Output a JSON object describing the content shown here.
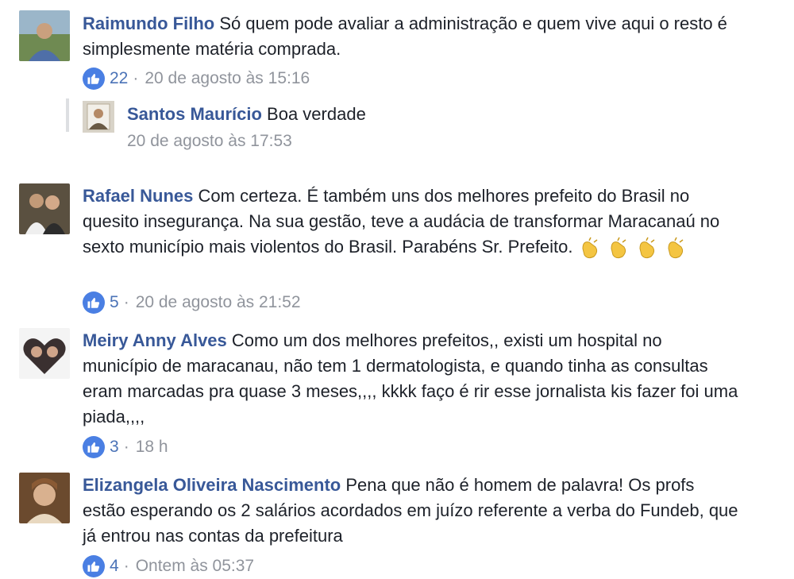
{
  "comments": [
    {
      "author": "Raimundo Filho",
      "text": "Só quem pode avaliar a administração e quem vive aqui o resto é simplesmente matéria comprada.",
      "likes": "22",
      "time": "20 de agosto às 15:16"
    },
    {
      "author": "Rafael Nunes",
      "text": "Com certeza. É também uns dos melhores prefeito do Brasil no quesito insegurança. Na sua gestão, teve a audácia de transformar Maracanaú no sexto município mais violentos do Brasil. Parabéns Sr. Prefeito.",
      "likes": "5",
      "time": "20 de agosto às 21:52",
      "emoji": "clapping-hands",
      "emoji_count": 4
    },
    {
      "author": "Meiry Anny Alves",
      "text": "Como um dos melhores prefeitos,, existi um hospital no município de maracanau, não tem 1 dermatologista, e quando tinha as consultas eram marcadas pra quase 3 meses,,,, kkkk faço é rir esse jornalista kis fazer foi uma piada,,,,",
      "likes": "3",
      "time": "18 h"
    },
    {
      "author": "Elizangela Oliveira Nascimento",
      "text": "Pena que não é homem de palavra! Os profs estão esperando os 2 salários acordados em juízo referente a verba do Fundeb, que já entrou nas contas da prefeitura",
      "likes": "4",
      "time": "Ontem às 05:37"
    }
  ],
  "reply": {
    "author": "Santos Maurício",
    "text": "Boa verdade",
    "time": "20 de agosto às 17:53"
  },
  "separator": "·",
  "colors": {
    "author": "#385898",
    "meta": "#90949c",
    "like_blue": "#4a7fe3",
    "like_count": "#4b73b7",
    "reply_bar": "#dddfe2"
  }
}
